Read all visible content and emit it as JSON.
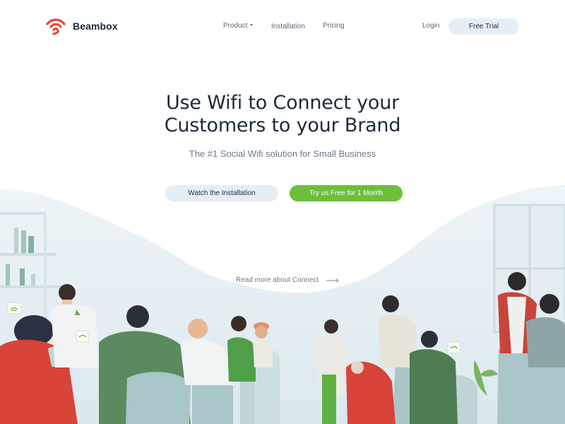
{
  "brand": {
    "name": "Beambox",
    "logo_icon": "wifi-logo-icon",
    "accent": "#e8473c"
  },
  "nav": {
    "items": [
      {
        "label": "Product",
        "has_dropdown": true
      },
      {
        "label": "Installation"
      },
      {
        "label": "Pricing"
      }
    ],
    "login": "Login",
    "trial": "Free Trial"
  },
  "hero": {
    "title_line1": "Use Wifi to Connect your",
    "title_line2": "Customers to your Brand",
    "subtitle": "The #1 Social Wifi solution for Small Business",
    "watch_label": "Watch the Installation",
    "try_label": "Try us Free for 1 Month",
    "read_more": "Read more about Connect",
    "read_more_icon": "arrow-right-icon"
  },
  "colors": {
    "text": "#1d2a3a",
    "muted": "#6c7a8c",
    "light_button": "#e5eef5",
    "green_button": "#6cbf3a"
  }
}
